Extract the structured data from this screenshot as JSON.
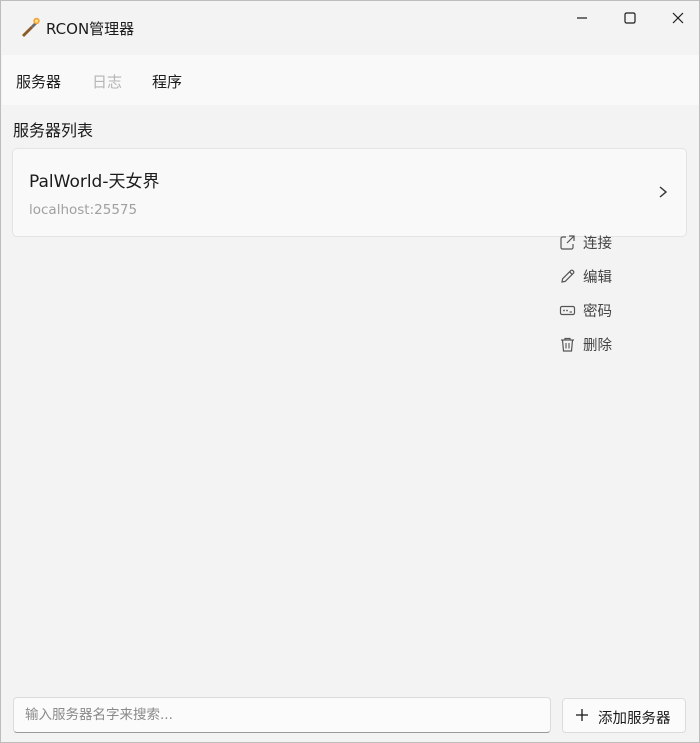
{
  "window": {
    "title": "RCON管理器",
    "icons": {
      "app": "torch-icon",
      "minimize": "minimize-icon",
      "maximize": "maximize-icon",
      "close": "close-icon"
    }
  },
  "nav": {
    "items": [
      {
        "label": "服务器",
        "state": "active"
      },
      {
        "label": "日志",
        "state": "disabled"
      },
      {
        "label": "程序",
        "state": "normal"
      }
    ]
  },
  "main": {
    "section_title": "服务器列表",
    "servers": [
      {
        "name": "PalWorld-天女界",
        "address": "localhost:25575",
        "icon": "chevron-right-icon"
      }
    ]
  },
  "context_menu": {
    "items": [
      {
        "label": "连接",
        "icon": "external-link-icon"
      },
      {
        "label": "编辑",
        "icon": "pencil-icon"
      },
      {
        "label": "密码",
        "icon": "password-icon"
      },
      {
        "label": "删除",
        "icon": "trash-icon"
      }
    ]
  },
  "footer": {
    "search_placeholder": "输入服务器名字来搜索...",
    "search_value": "",
    "add_button_label": "添加服务器",
    "add_icon": "plus-icon"
  },
  "colors": {
    "background": "#f3f3f3",
    "card": "#f9f9f9",
    "text": "#1b1b1b",
    "muted_text": "#a0a0a0",
    "disabled_text": "#b5b5b5"
  }
}
